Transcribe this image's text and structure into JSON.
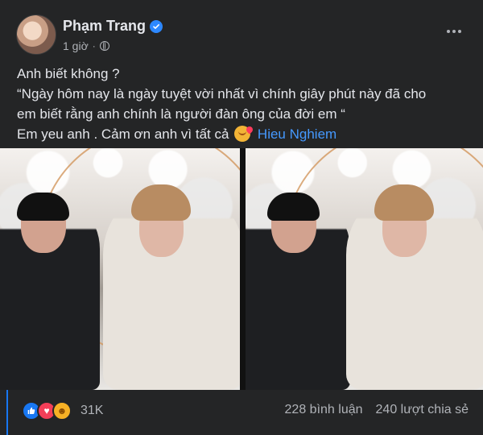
{
  "post": {
    "author": "Phạm Trang",
    "time": "1 giờ",
    "separator": "·",
    "text_lines": [
      "Anh biết không ?",
      " “Ngày hôm nay là ngày tuyệt vời nhất vì chính giây phút này đã cho",
      "em biết rằng anh chính là người đàn ông của đời em “",
      "Em yeu anh . Cảm ơn anh vì tất cả"
    ],
    "tag": "Hieu Nghiem"
  },
  "engagement": {
    "reaction_count": "31K",
    "comments": "228 bình luận",
    "shares": "240 lượt chia sẻ"
  },
  "icons": {
    "verified": "verified-icon",
    "globe": "globe-icon",
    "more": "more-options-icon",
    "like": "like-reaction-icon",
    "love": "love-reaction-icon",
    "care": "care-reaction-icon",
    "emoji": "smiling-face-with-hearts-icon"
  },
  "colors": {
    "background": "#242526",
    "text": "#e4e6eb",
    "secondary_text": "#b0b3b8",
    "link": "#4599ff",
    "verified": "#2d88ff"
  }
}
